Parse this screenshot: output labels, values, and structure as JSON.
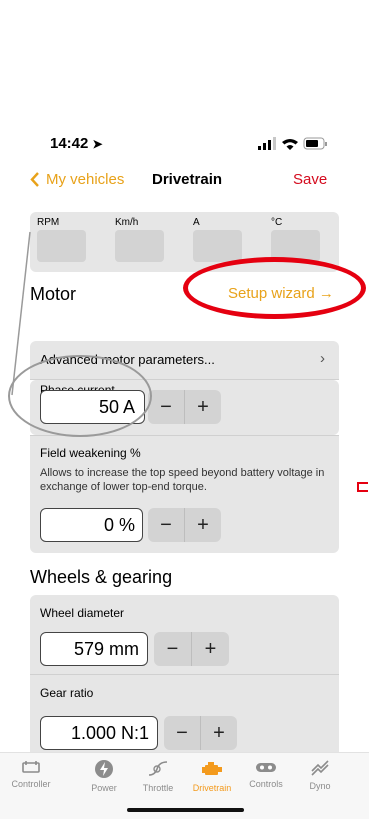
{
  "status": {
    "time": "14:42"
  },
  "nav": {
    "back_label": "My vehicles",
    "title": "Drivetrain",
    "save_label": "Save"
  },
  "gauges": [
    {
      "label": "RPM"
    },
    {
      "label": "Km/h"
    },
    {
      "label": "A"
    },
    {
      "label": "°C"
    }
  ],
  "motor": {
    "heading": "Motor",
    "setup_wizard": "Setup wizard →",
    "advanced_label": "Advanced motor parameters...",
    "phase_current": {
      "label": "Phase current",
      "value": "50 A"
    },
    "field_weakening": {
      "label": "Field weakening %",
      "description": "Allows to increase the top speed beyond battery voltage in exchange of lower top-end torque.",
      "value": "0 %"
    }
  },
  "wheels": {
    "heading": "Wheels & gearing",
    "wheel_diameter": {
      "label": "Wheel diameter",
      "value": "579 mm"
    },
    "gear_ratio": {
      "label": "Gear ratio",
      "value": "1.000 N:1"
    }
  },
  "stepper": {
    "minus": "−",
    "plus": "+"
  },
  "tabs": [
    {
      "label": "Controller",
      "icon": "controller-icon"
    },
    {
      "label": "Power",
      "icon": "power-icon"
    },
    {
      "label": "Throttle",
      "icon": "throttle-icon"
    },
    {
      "label": "Drivetrain",
      "icon": "motor-icon",
      "active": true
    },
    {
      "label": "Controls",
      "icon": "gamepad-icon"
    },
    {
      "label": "Dyno",
      "icon": "dyno-icon"
    }
  ],
  "colors": {
    "accent": "#e8a21a",
    "save": "#d40b1e",
    "annotation": "#e50010",
    "tab_active": "#f39a1d"
  }
}
